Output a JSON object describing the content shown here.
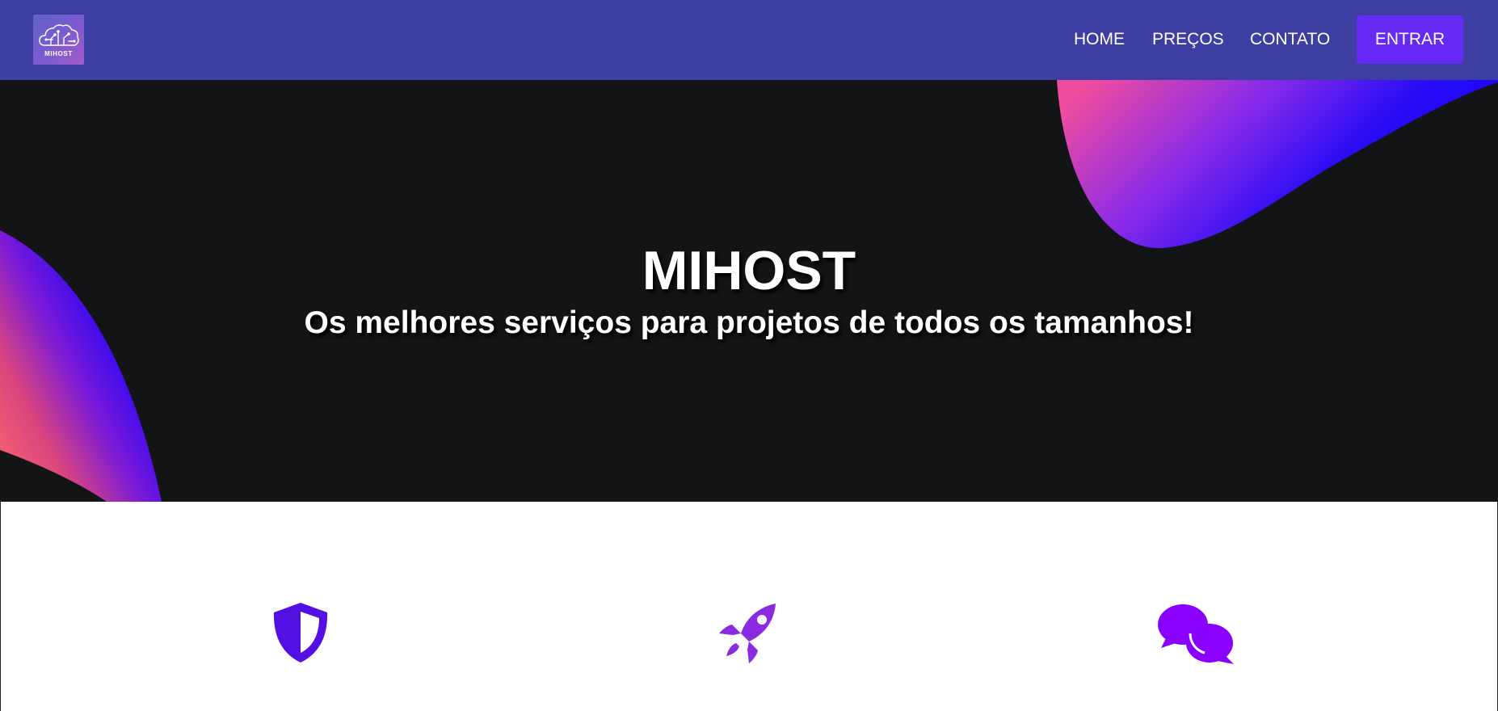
{
  "navbar": {
    "logo_text": "MIHOST",
    "links": [
      {
        "label": "HOME"
      },
      {
        "label": "PREÇOS"
      },
      {
        "label": "CONTATO"
      }
    ],
    "login_button": "ENTRAR",
    "colors": {
      "background": "#3c3fa1",
      "button": "#6729f5"
    }
  },
  "hero": {
    "title": "MIHOST",
    "subtitle": "Os melhores serviços para projetos de todos os tamanhos!",
    "background": "#131416"
  },
  "features": {
    "icons": [
      {
        "name": "shield-icon",
        "color": "#5210e2"
      },
      {
        "name": "rocket-icon",
        "color": "#8a2be2"
      },
      {
        "name": "chat-icon",
        "color": "#8a00ff"
      }
    ]
  }
}
